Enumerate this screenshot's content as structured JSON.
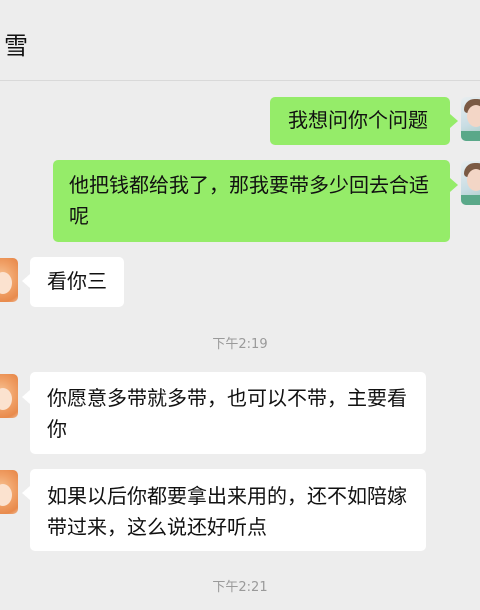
{
  "header": {
    "title": "雪"
  },
  "messages": [
    {
      "side": "right",
      "text": "我想问你个问题"
    },
    {
      "side": "right",
      "text_lines": [
        "他把钱都给我了，那我要带多少回去合适",
        "呢"
      ]
    },
    {
      "side": "left",
      "text": "看你三"
    },
    {
      "type": "time",
      "text": "下午2:19"
    },
    {
      "side": "left",
      "text_lines": [
        "你愿意多带就多带，也可以不带，主要看",
        "你"
      ]
    },
    {
      "side": "left",
      "text_lines": [
        "如果以后你都要拿出来用的，还不如陪嫁",
        "带过来，这么说还好听点"
      ]
    },
    {
      "type": "time",
      "text": "下午2:21"
    }
  ],
  "colors": {
    "sent_bubble": "#95ec69",
    "received_bubble": "#ffffff",
    "background": "#ededed"
  }
}
